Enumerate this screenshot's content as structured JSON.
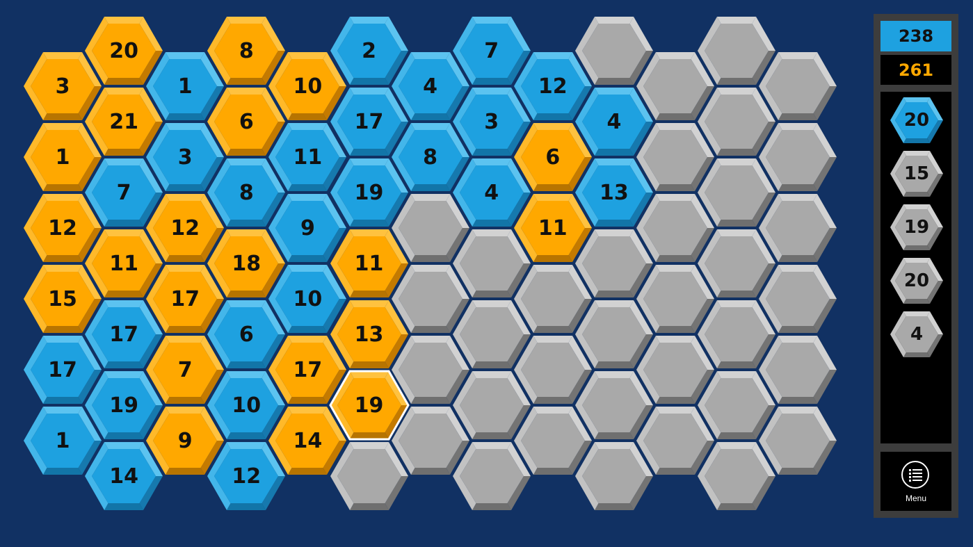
{
  "colors": {
    "background": "#113163",
    "blue": "#1ea1e0",
    "orange": "#ffa800",
    "gray": "#a9a9a9",
    "selected_outline": "#ffffff"
  },
  "board": {
    "columns": [
      [
        {
          "color": "orange",
          "value": "3"
        },
        {
          "color": "orange",
          "value": "1"
        },
        {
          "color": "orange",
          "value": "12"
        },
        {
          "color": "orange",
          "value": "15"
        },
        {
          "color": "blue",
          "value": "17"
        },
        {
          "color": "blue",
          "value": "1"
        }
      ],
      [
        {
          "color": "orange",
          "value": "20"
        },
        {
          "color": "orange",
          "value": "21"
        },
        {
          "color": "blue",
          "value": "7"
        },
        {
          "color": "orange",
          "value": "11"
        },
        {
          "color": "blue",
          "value": "17"
        },
        {
          "color": "blue",
          "value": "19"
        },
        {
          "color": "blue",
          "value": "14"
        }
      ],
      [
        {
          "color": "blue",
          "value": "1"
        },
        {
          "color": "blue",
          "value": "3"
        },
        {
          "color": "orange",
          "value": "12"
        },
        {
          "color": "orange",
          "value": "17"
        },
        {
          "color": "orange",
          "value": "7"
        },
        {
          "color": "orange",
          "value": "9"
        }
      ],
      [
        {
          "color": "orange",
          "value": "8"
        },
        {
          "color": "orange",
          "value": "6"
        },
        {
          "color": "blue",
          "value": "8"
        },
        {
          "color": "orange",
          "value": "18"
        },
        {
          "color": "blue",
          "value": "6"
        },
        {
          "color": "blue",
          "value": "10"
        },
        {
          "color": "blue",
          "value": "12"
        }
      ],
      [
        {
          "color": "orange",
          "value": "10"
        },
        {
          "color": "blue",
          "value": "11"
        },
        {
          "color": "blue",
          "value": "9"
        },
        {
          "color": "blue",
          "value": "10"
        },
        {
          "color": "orange",
          "value": "17"
        },
        {
          "color": "orange",
          "value": "14"
        }
      ],
      [
        {
          "color": "blue",
          "value": "2"
        },
        {
          "color": "blue",
          "value": "17"
        },
        {
          "color": "blue",
          "value": "19"
        },
        {
          "color": "orange",
          "value": "11"
        },
        {
          "color": "orange",
          "value": "13"
        },
        {
          "color": "orange",
          "value": "19",
          "selected": true
        },
        {
          "color": "gray",
          "value": ""
        }
      ],
      [
        {
          "color": "blue",
          "value": "4"
        },
        {
          "color": "blue",
          "value": "8"
        },
        {
          "color": "gray",
          "value": ""
        },
        {
          "color": "gray",
          "value": ""
        },
        {
          "color": "gray",
          "value": ""
        },
        {
          "color": "gray",
          "value": ""
        }
      ],
      [
        {
          "color": "blue",
          "value": "7"
        },
        {
          "color": "blue",
          "value": "3"
        },
        {
          "color": "blue",
          "value": "4"
        },
        {
          "color": "gray",
          "value": ""
        },
        {
          "color": "gray",
          "value": ""
        },
        {
          "color": "gray",
          "value": ""
        },
        {
          "color": "gray",
          "value": ""
        }
      ],
      [
        {
          "color": "blue",
          "value": "12"
        },
        {
          "color": "orange",
          "value": "6"
        },
        {
          "color": "orange",
          "value": "11"
        },
        {
          "color": "gray",
          "value": ""
        },
        {
          "color": "gray",
          "value": ""
        },
        {
          "color": "gray",
          "value": ""
        }
      ],
      [
        {
          "color": "gray",
          "value": ""
        },
        {
          "color": "blue",
          "value": "4"
        },
        {
          "color": "blue",
          "value": "13"
        },
        {
          "color": "gray",
          "value": ""
        },
        {
          "color": "gray",
          "value": ""
        },
        {
          "color": "gray",
          "value": ""
        },
        {
          "color": "gray",
          "value": ""
        }
      ],
      [
        {
          "color": "gray",
          "value": ""
        },
        {
          "color": "gray",
          "value": ""
        },
        {
          "color": "gray",
          "value": ""
        },
        {
          "color": "gray",
          "value": ""
        },
        {
          "color": "gray",
          "value": ""
        },
        {
          "color": "gray",
          "value": ""
        }
      ],
      [
        {
          "color": "gray",
          "value": ""
        },
        {
          "color": "gray",
          "value": ""
        },
        {
          "color": "gray",
          "value": ""
        },
        {
          "color": "gray",
          "value": ""
        },
        {
          "color": "gray",
          "value": ""
        },
        {
          "color": "gray",
          "value": ""
        },
        {
          "color": "gray",
          "value": ""
        }
      ],
      [
        {
          "color": "gray",
          "value": ""
        },
        {
          "color": "gray",
          "value": ""
        },
        {
          "color": "gray",
          "value": ""
        },
        {
          "color": "gray",
          "value": ""
        },
        {
          "color": "gray",
          "value": ""
        },
        {
          "color": "gray",
          "value": ""
        }
      ]
    ]
  },
  "sidebar": {
    "score_blue": "238",
    "score_orange": "261",
    "queue": [
      {
        "color": "blue",
        "value": "20"
      },
      {
        "color": "gray",
        "value": "15"
      },
      {
        "color": "gray",
        "value": "19"
      },
      {
        "color": "gray",
        "value": "20"
      },
      {
        "color": "gray",
        "value": "4"
      }
    ],
    "menu_label": "Menu",
    "menu_icon": "list-icon"
  }
}
